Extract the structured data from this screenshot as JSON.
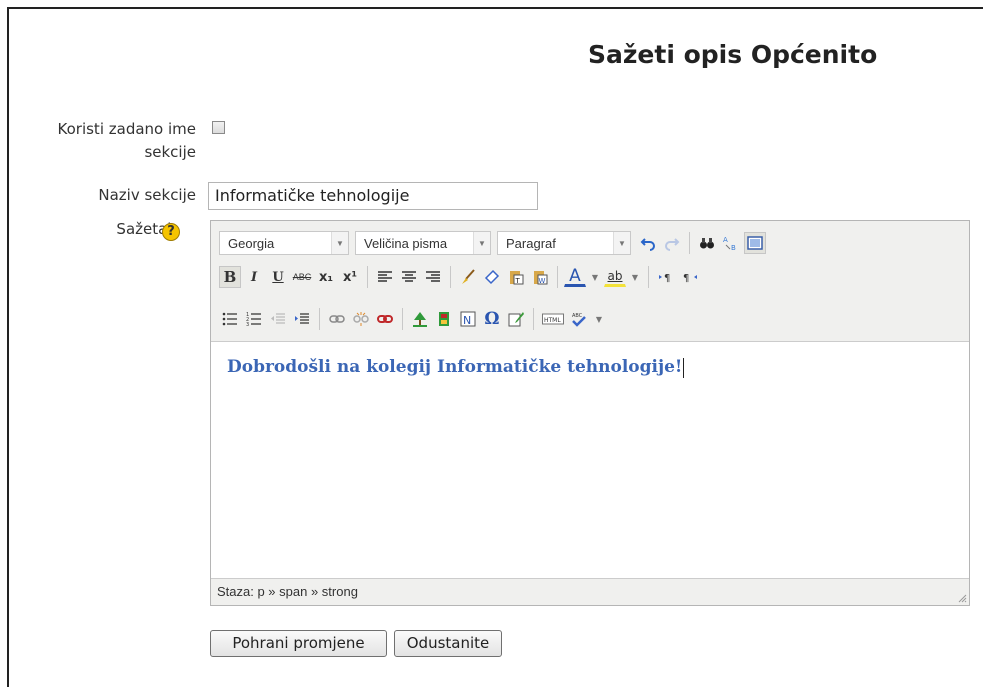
{
  "page": {
    "title": "Sažeti opis Općenito"
  },
  "form": {
    "use_default_label": "Koristi zadano ime sekcije",
    "use_default_checked": false,
    "section_name_label": "Naziv sekcije",
    "section_name_value": "Informatičke tehnologije",
    "summary_label": "Sažetak",
    "help_symbol": "?"
  },
  "editor": {
    "font_select": "Georgia",
    "size_select": "Veličina pisma",
    "format_select": "Paragraf",
    "content_text": "Dobrodošli na kolegij Informatičke tehnologije!",
    "status_path": "Staza: p » span » strong",
    "buttons": {
      "bold": "B",
      "italic": "I",
      "underline": "U",
      "strike": "ABC",
      "subscript": "x₁",
      "superscript": "x¹",
      "text_color": "A",
      "highlight": "ab"
    },
    "colors": {
      "content": "#3b66b5",
      "toolbar": "#f0f0ee"
    }
  },
  "actions": {
    "save_label": "Pohrani promjene",
    "cancel_label": "Odustanite"
  }
}
